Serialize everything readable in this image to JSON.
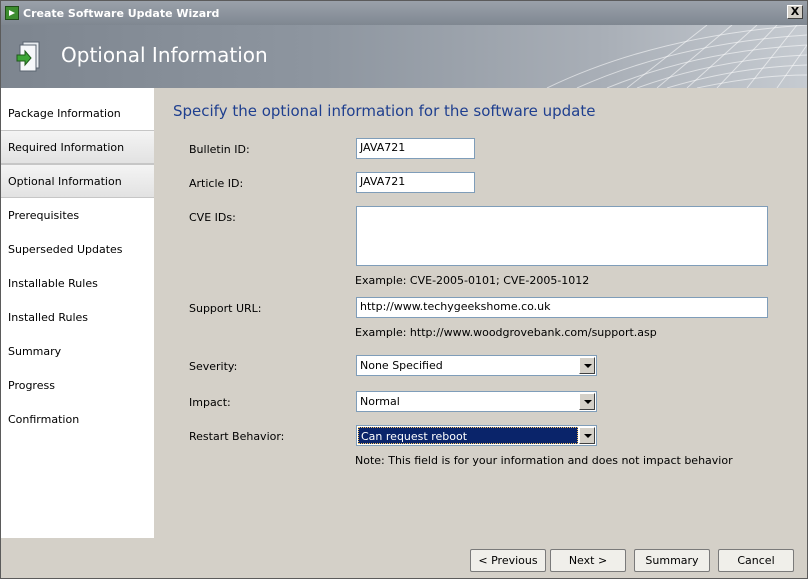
{
  "window": {
    "title": "Create Software Update Wizard",
    "close_glyph": "X"
  },
  "banner": {
    "title": "Optional Information",
    "icon": "wizard-page-icon"
  },
  "nav": {
    "items": [
      "Package Information",
      "Required Information",
      "Optional Information",
      "Prerequisites",
      "Superseded Updates",
      "Installable Rules",
      "Installed Rules",
      "Summary",
      "Progress",
      "Confirmation"
    ],
    "selected_index": 2
  },
  "content": {
    "heading": "Specify the optional information for the software update",
    "bulletin_label": "Bulletin ID:",
    "bulletin_value": "JAVA721",
    "article_label": "Article ID:",
    "article_value": "JAVA721",
    "cve_label": "CVE IDs:",
    "cve_value": "",
    "cve_example": "Example: CVE-2005-0101; CVE-2005-1012",
    "support_label": "Support URL:",
    "support_value": "http://www.techygeekshome.co.uk",
    "support_example": "Example: http://www.woodgrovebank.com/support.asp",
    "severity_label": "Severity:",
    "severity_value": "None Specified",
    "impact_label": "Impact:",
    "impact_value": "Normal",
    "restart_label": "Restart Behavior:",
    "restart_value": "Can request reboot",
    "note": "Note: This field is for your information and does not impact behavior"
  },
  "footer": {
    "previous": "< Previous",
    "next": "Next >",
    "summary": "Summary",
    "cancel": "Cancel"
  },
  "colors": {
    "heading": "#1f3f8f",
    "selection": "#0a246a",
    "panel": "#d4d0c8"
  }
}
